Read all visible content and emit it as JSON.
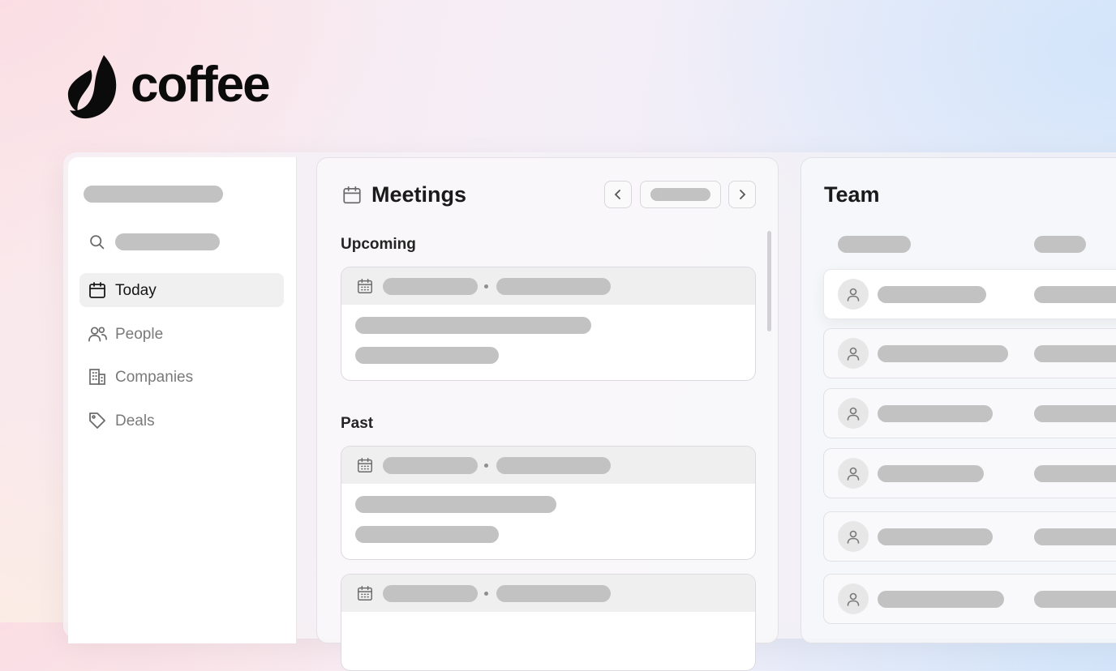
{
  "brand": {
    "name": "coffee",
    "logo_icon": "coffee-bean-logo-icon"
  },
  "sidebar": {
    "search_icon": "search-icon",
    "items": [
      {
        "label": "Today",
        "icon": "calendar-icon",
        "active": true
      },
      {
        "label": "People",
        "icon": "people-icon",
        "active": false
      },
      {
        "label": "Companies",
        "icon": "building-icon",
        "active": false
      },
      {
        "label": "Deals",
        "icon": "tag-icon",
        "active": false
      }
    ]
  },
  "meetings": {
    "title": "Meetings",
    "title_icon": "calendar-icon",
    "prev_icon": "chevron-left-icon",
    "next_icon": "chevron-right-icon",
    "upcoming_label": "Upcoming",
    "past_label": "Past"
  },
  "team": {
    "title": "Team",
    "row_icon": "person-icon"
  },
  "colors": {
    "placeholder": "#c2c2c2",
    "active_nav_bg": "#f0f0f0",
    "text_primary": "#1a1a1a",
    "text_muted": "#7a7a7a"
  }
}
